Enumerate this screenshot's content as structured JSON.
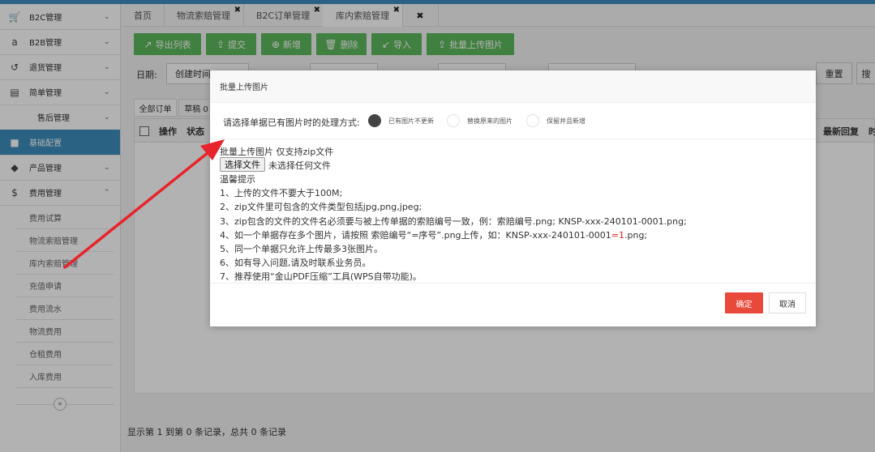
{
  "colors": {
    "sidebar_active": "#3c8dbc",
    "toolbar_green": "#5cb85c",
    "confirm_red": "#e9493a",
    "arrow_red": "#e8232b"
  },
  "sidebar": {
    "items": [
      {
        "label": "B2C管理",
        "icon": "cart-icon",
        "glyph": "🛒",
        "chevron": "⌄"
      },
      {
        "label": "B2B管理",
        "icon": "amazon-icon",
        "glyph": "a",
        "chevron": "⌄"
      },
      {
        "label": "退货管理",
        "icon": "undo-icon",
        "glyph": "↺",
        "chevron": "⌄"
      },
      {
        "label": "简单管理",
        "icon": "file-icon",
        "glyph": "▤",
        "chevron": "⌄"
      },
      {
        "label": "售后管理",
        "icon": "",
        "glyph": "",
        "chevron": "⌄"
      },
      {
        "label": "基础配置",
        "icon": "folder-icon",
        "glyph": "■",
        "chevron": ""
      },
      {
        "label": "产品管理",
        "icon": "tag-icon",
        "glyph": "◆",
        "chevron": "⌄"
      },
      {
        "label": "费用管理",
        "icon": "dollar-icon",
        "glyph": "$",
        "chevron": "⌃"
      }
    ],
    "sub_items": [
      "费用试算",
      "物流索赔管理",
      "库内索赔管理",
      "充值申请",
      "费用流水",
      "物流费用",
      "仓租费用",
      "入库费用"
    ],
    "collapse_glyph": "«"
  },
  "tabs": [
    {
      "label": "首页",
      "close": ""
    },
    {
      "label": "物流索赔管理",
      "close": "✖"
    },
    {
      "label": "B2C订单管理",
      "close": "✖"
    },
    {
      "label": "库内索赔管理",
      "close": "✖"
    },
    {
      "label": "",
      "close": "✖"
    }
  ],
  "toolbar": {
    "buttons": [
      {
        "label": "导出列表",
        "glyph": "↗"
      },
      {
        "label": "提交",
        "glyph": "⇪"
      },
      {
        "label": "新增",
        "glyph": "⊕"
      },
      {
        "label": "删除",
        "glyph": "🗑"
      },
      {
        "label": "导入",
        "glyph": "↙"
      },
      {
        "label": "批量上传图片",
        "glyph": "⇪"
      }
    ]
  },
  "filters": {
    "date_label": "日期:",
    "date_type": "创建时间",
    "reset": "重置",
    "search": "搜"
  },
  "table": {
    "subtabs": [
      "全部订单",
      "草稿 0"
    ],
    "columns": [
      "操作",
      "状态",
      "最新回复",
      "时"
    ]
  },
  "footer": {
    "text": "显示第 1 到第 0 条记录，总共 0 条记录"
  },
  "dialog": {
    "title": "批量上传图片",
    "option_title": "请选择单据已有图片时的处理方式:",
    "options": [
      "已有图片不更新",
      "替换原来的图片",
      "保留并且新增"
    ],
    "upload_label": "批量上传图片 仅支持zip文件",
    "file_button": "选择文件",
    "file_none": "未选择任何文件",
    "tips_title": "温馨提示",
    "tips": [
      "1、上传的文件不要大于100M;",
      "2、zip文件里可包含的文件类型包括jpg,png,jpeg;",
      "3、zip包含的文件的文件名必须要与被上传单据的索赔编号一致，例：索赔编号.png; KNSP-xxx-240101-0001.png;",
      "5、同一个单据只允许上传最多3张图片。",
      "6、如有导入问题,请及时联系业务员。",
      "7、推荐使用“金山PDF压缩”工具(WPS自带功能)。"
    ],
    "tip4": {
      "before": "4、如一个单据存在多个图片，请按照 索赔编号“=序号”.png上传，如：KNSP-xxx-240101-0001",
      "red": "=1",
      "after": ".png;"
    },
    "confirm": "确定",
    "cancel": "取消"
  }
}
